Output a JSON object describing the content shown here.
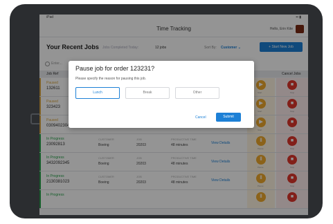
{
  "statusbar": {
    "carrier": "iPad",
    "battery": "▪▪ ▮"
  },
  "navbar": {
    "title": "Time Tracking",
    "user": "Hello, Erin Kite"
  },
  "header": {
    "title": "Your Recent Jobs",
    "count_label": "Jobs Completed Today:",
    "count_value": "12 jobs",
    "sort_label": "Sort By:",
    "sort_value": "Customer ⌄",
    "start_button": "+ Start New Job"
  },
  "search": {
    "placeholder": "Enter..."
  },
  "table": {
    "col_job": "Job Ref",
    "col_cancel": "Cancel Jobs",
    "rows": [
      {
        "status": "Paused",
        "order": "132611",
        "c1l": "",
        "c1v": "",
        "c2l": "",
        "c2v": "",
        "c3l": "",
        "c3v": "",
        "details": "View Details",
        "pause_label": "Start",
        "cancel_label": "Stop"
      },
      {
        "status": "Paused",
        "order": "323423",
        "c1l": "",
        "c1v": "",
        "c2l": "",
        "c2v": "",
        "c3l": "",
        "c3v": "",
        "details": "View Details",
        "pause_label": "Start",
        "cancel_label": "Stop"
      },
      {
        "status": "Paused",
        "order": "03094023042",
        "c1l": "CUSTOMER",
        "c1v": "Boeing",
        "c2l": "JOB",
        "c2v": "20203",
        "c3l": "PRODUCTIVE TIME",
        "c3v": "48 minutes",
        "details": "View Details",
        "pause_label": "Start",
        "cancel_label": "Stop"
      },
      {
        "status": "In Progress",
        "order": "23092813",
        "c1l": "CUSTOMER",
        "c1v": "Boeing",
        "c2l": "JOB",
        "c2v": "20203",
        "c3l": "PRODUCTIVE TIME",
        "c3v": "48 minutes",
        "details": "View Details",
        "pause_label": "Pause",
        "cancel_label": "Stop"
      },
      {
        "status": "In Progress",
        "order": "3432092345",
        "c1l": "CUSTOMER",
        "c1v": "Boeing",
        "c2l": "JOB",
        "c2v": "20203",
        "c3l": "PRODUCTIVE TIME",
        "c3v": "48 minutes",
        "details": "View Details",
        "pause_label": "Pause",
        "cancel_label": "Stop"
      },
      {
        "status": "In Progress",
        "order": "2130381023",
        "c1l": "CUSTOMER",
        "c1v": "Boeing",
        "c2l": "JOB",
        "c2v": "20203",
        "c3l": "PRODUCTIVE TIME",
        "c3v": "48 minutes",
        "details": "View Details",
        "pause_label": "Pause",
        "cancel_label": "Stop"
      },
      {
        "status": "In Progress",
        "order": "",
        "c1l": "",
        "c1v": "",
        "c2l": "",
        "c2v": "",
        "c3l": "",
        "c3v": "",
        "details": "",
        "pause_label": "",
        "cancel_label": ""
      }
    ]
  },
  "modal": {
    "title": "Pause job for order 123231?",
    "subtitle": "Please specify the reason for pausing this job.",
    "options": [
      "Lunch",
      "Break",
      "Other"
    ],
    "cancel": "Cancel",
    "submit": "Submit"
  },
  "colors": {
    "accent": "#1d80d6",
    "paused": "#d9a640",
    "in_progress": "#27a34a",
    "pause_button": "#f0a92b",
    "stop_button": "#e0362c"
  }
}
